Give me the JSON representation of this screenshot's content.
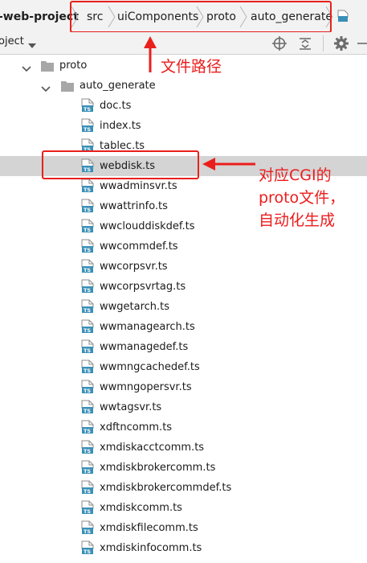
{
  "breadcrumb": {
    "project": "-web-project",
    "items": [
      "src",
      "uiComponents",
      "proto",
      "auto_generate"
    ],
    "file_icon": "typescript-file-icon"
  },
  "toolbar": {
    "project_label": "oject",
    "icons": [
      "target-icon",
      "collapse-all-icon",
      "gear-icon",
      "hide-icon"
    ]
  },
  "tree": {
    "folders": [
      {
        "label": "proto",
        "expanded": true
      },
      {
        "label": "auto_generate",
        "expanded": true
      }
    ],
    "file_badge": "TS",
    "files": [
      "doc.ts",
      "index.ts",
      "tablec.ts",
      "webdisk.ts",
      "wwadminsvr.ts",
      "wwattrinfo.ts",
      "wwclouddiskdef.ts",
      "wwcommdef.ts",
      "wwcorpsvr.ts",
      "wwcorpsvrtag.ts",
      "wwgetarch.ts",
      "wwmanagearch.ts",
      "wwmanagedef.ts",
      "wwmngcachedef.ts",
      "wwmngopersvr.ts",
      "wwtagsvr.ts",
      "xdftncomm.ts",
      "xmdiskacctcomm.ts",
      "xmdiskbrokercomm.ts",
      "xmdiskbrokercommdef.ts",
      "xmdiskcomm.ts",
      "xmdiskfilecomm.ts",
      "xmdiskinfocomm.ts"
    ],
    "selected_file": "webdisk.ts"
  },
  "annotations": {
    "path_note": "文件路径",
    "file_note_lines": [
      "对应CGI的",
      "proto文件，",
      "自动化生成"
    ],
    "color": "#ec1c1c"
  }
}
